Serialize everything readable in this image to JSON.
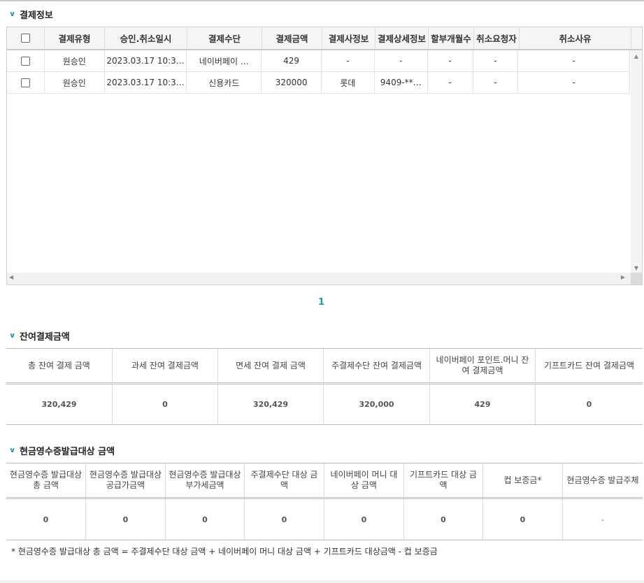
{
  "payment_section": {
    "title": "결제정보",
    "columns": [
      "결제유형",
      "승인.취소일시",
      "결제수단",
      "결제금액",
      "결제사정보",
      "결제상세정보",
      "할부개월수",
      "취소요청자",
      "취소사유"
    ],
    "rows": [
      {
        "type": "원승인",
        "datetime": "2023.03.17 10:3…",
        "method": "네이버페이 …",
        "amount": "429",
        "company": "-",
        "detail": "-",
        "installment": "-",
        "canceller": "-",
        "reason": "-"
      },
      {
        "type": "원승인",
        "datetime": "2023.03.17 10:3…",
        "method": "신용카드",
        "amount": "320000",
        "company": "롯데",
        "detail": "9409-**…",
        "installment": "-",
        "canceller": "-",
        "reason": "-"
      }
    ],
    "page": "1"
  },
  "remaining_section": {
    "title": "잔여결제금액",
    "headers": [
      "총 잔여 결제 금액",
      "과세 잔여 결제금액",
      "면세 잔여 결제 금액",
      "주결제수단 잔여 결제금액",
      "네이버페이 포인트.머니 잔여 결제금액",
      "기프트카드 잔여 결제금액"
    ],
    "values": [
      "320,429",
      "0",
      "320,429",
      "320,000",
      "429",
      "0"
    ]
  },
  "receipt_section": {
    "title": "현금영수증발급대상 금액",
    "headers": [
      "현금영수증 발급대상 총 금액",
      "현금영수증 발급대상 공급가금액",
      "현금영수증 발급대상 부가세금액",
      "주결제수단 대상 금액",
      "네이버페이 머니 대상 금액",
      "기프트카드 대상 금액",
      "컵 보증금*",
      "현금영수증 발급주체"
    ],
    "values": [
      "0",
      "0",
      "0",
      "0",
      "0",
      "0",
      "0",
      "-"
    ]
  },
  "footnote": "* 현금영수증 발급대상 총 금액 = 주결제수단 대상 금액 + 네이버페이 머니 대상 금액 + 기프트카드 대상금액 - 컵 보증금",
  "colors": {
    "accent": "#1b9aa8",
    "border": "#bdbdbd",
    "header_bg": "#f5f5f5"
  }
}
